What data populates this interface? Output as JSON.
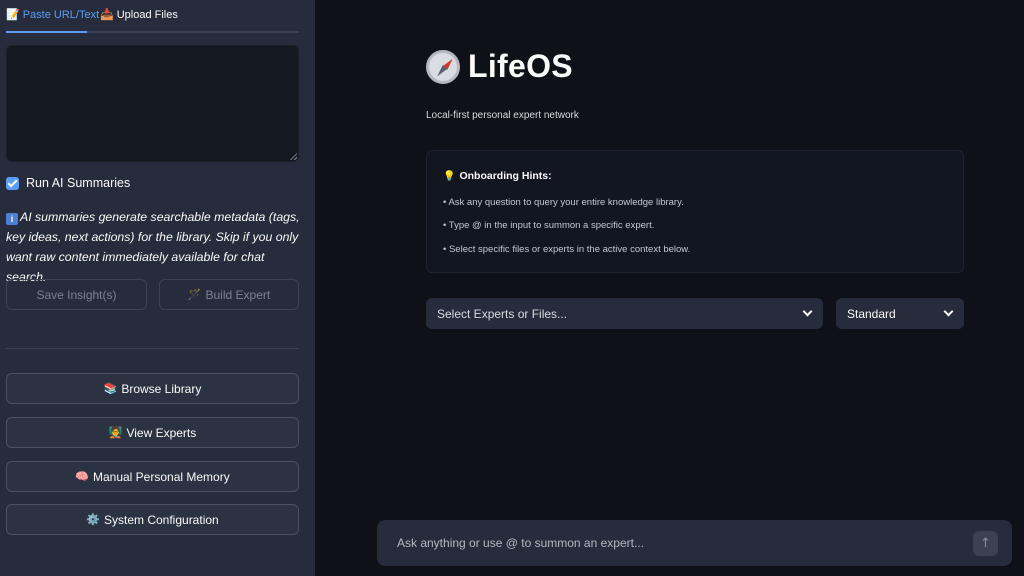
{
  "sidebar": {
    "tabs": [
      {
        "icon": "📝",
        "label": "Paste URL/Text",
        "active": true
      },
      {
        "icon": "📥",
        "label": "Upload Files",
        "active": false
      }
    ],
    "textarea_value": "",
    "checkbox": {
      "label": "Run AI Summaries",
      "checked": true
    },
    "info_text": "AI summaries generate searchable metadata (tags, key ideas, next actions) for the library. Skip if you only want raw content immediately available for chat search.",
    "save_button": "Save Insight(s)",
    "build_button": {
      "icon": "🪄",
      "label": "Build Expert"
    },
    "nav": [
      {
        "icon": "📚",
        "label": "Browse Library"
      },
      {
        "icon": "🧑‍🏫",
        "label": "View Experts"
      },
      {
        "icon": "🧠",
        "label": "Manual Personal Memory"
      },
      {
        "icon": "⚙️",
        "label": "System Configuration"
      }
    ]
  },
  "main": {
    "title": "LifeOS",
    "subtitle": "Local-first personal expert network",
    "hints": {
      "icon": "💡",
      "title": "Onboarding Hints:",
      "items": [
        "• Ask any question to query your entire knowledge library.",
        "• Type @ in the input to summon a specific expert.",
        "• Select specific files or experts in the active context below."
      ]
    },
    "expert_select": "Select Experts or Files...",
    "mode_select": "Standard",
    "chat_placeholder": "Ask anything or use @ to summon an expert..."
  },
  "colors": {
    "accent": "#5c9cf5",
    "background": "#0e1117",
    "sidebar": "#262c3b"
  }
}
